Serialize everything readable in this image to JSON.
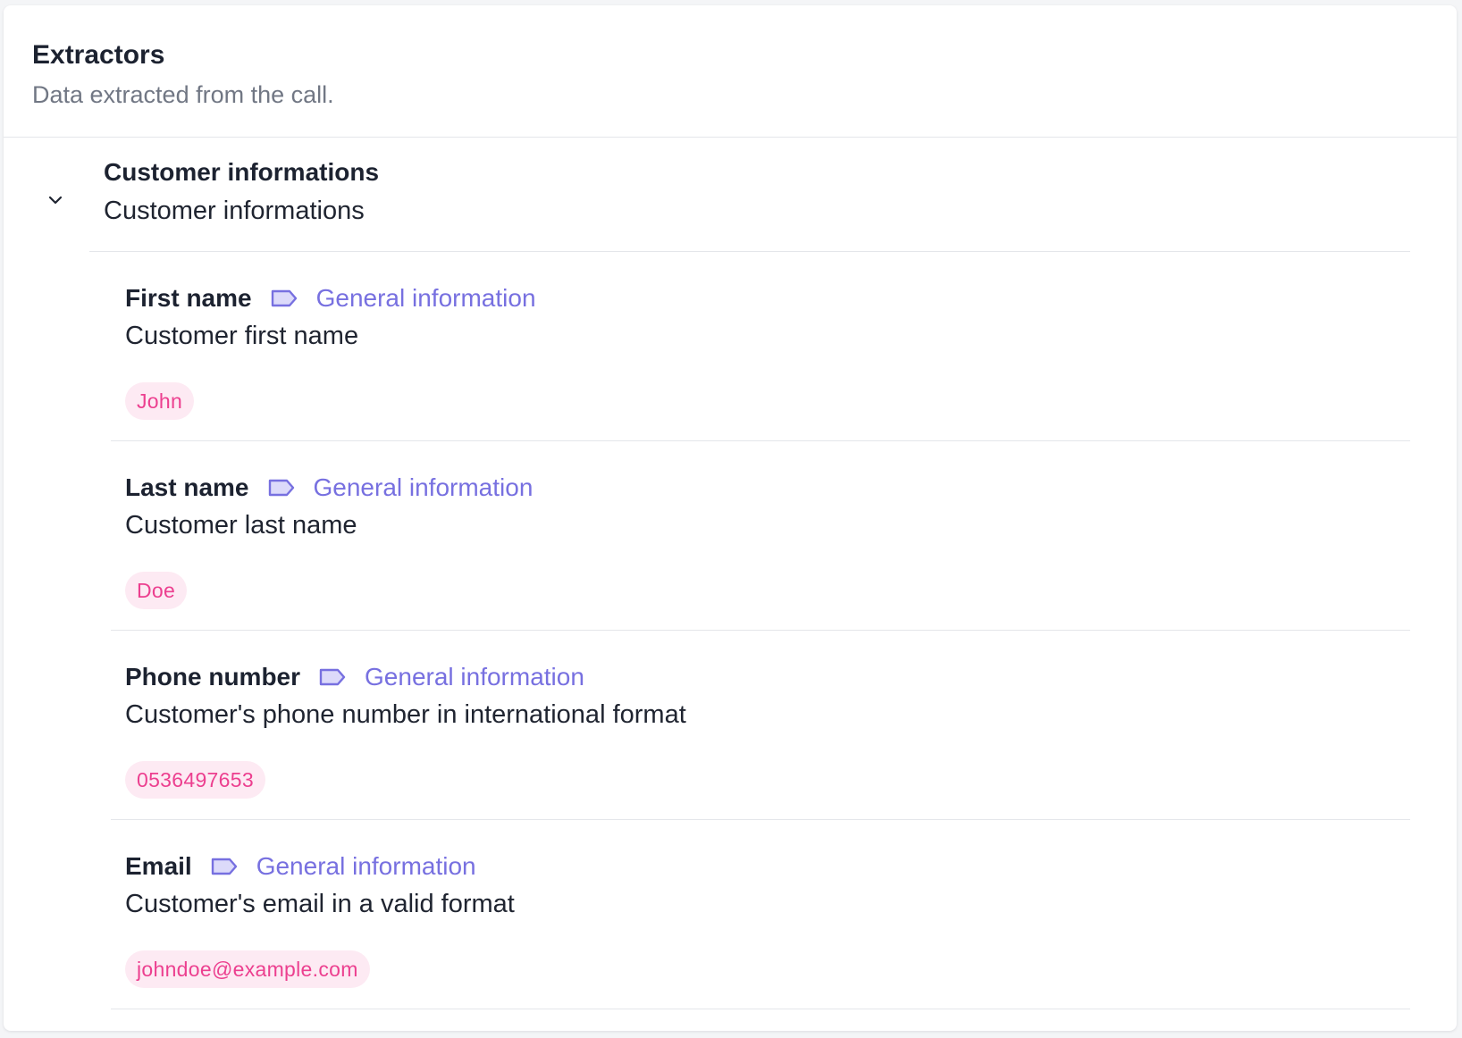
{
  "header": {
    "title": "Extractors",
    "subtitle": "Data extracted from the call."
  },
  "group": {
    "title": "Customer informations",
    "description": "Customer informations",
    "expanded": true,
    "icon": "chevron-down-icon"
  },
  "fields": [
    {
      "name": "First name",
      "category": "General information",
      "category_icon": "tag-icon",
      "description": "Customer first name",
      "value": "John"
    },
    {
      "name": "Last name",
      "category": "General information",
      "category_icon": "tag-icon",
      "description": "Customer last name",
      "value": "Doe"
    },
    {
      "name": "Phone number",
      "category": "General information",
      "category_icon": "tag-icon",
      "description": "Customer's phone number in international format",
      "value": "0536497653"
    },
    {
      "name": "Email",
      "category": "General information",
      "category_icon": "tag-icon",
      "description": "Customer's email in a valid format",
      "value": "johndoe@example.com"
    }
  ],
  "colors": {
    "accent": "#7770e0",
    "tag_fill": "#dcdafa",
    "value_text": "#ec3f8f",
    "value_bg": "#fdeaf3",
    "divider": "#e4e6ea"
  }
}
